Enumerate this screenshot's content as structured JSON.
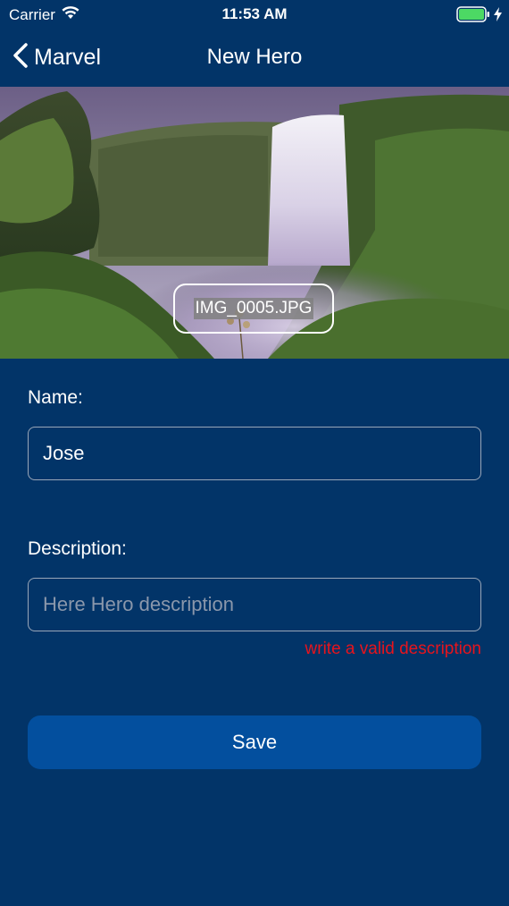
{
  "status_bar": {
    "carrier": "Carrier",
    "time": "11:53 AM",
    "icons": [
      "wifi-icon",
      "battery-icon",
      "charging-bolt-icon"
    ],
    "battery_color": "#4cd964"
  },
  "nav": {
    "back_label": "Marvel",
    "title": "New Hero"
  },
  "hero_image": {
    "file_name": "IMG_0005.JPG"
  },
  "form": {
    "name_label": "Name:",
    "name_value": "Jose",
    "description_label": "Description:",
    "description_placeholder": "Here Hero description",
    "description_error": "write a valid description",
    "save_label": "Save"
  },
  "colors": {
    "background": "#023468",
    "button": "#034f9e",
    "error": "#e8141c"
  }
}
